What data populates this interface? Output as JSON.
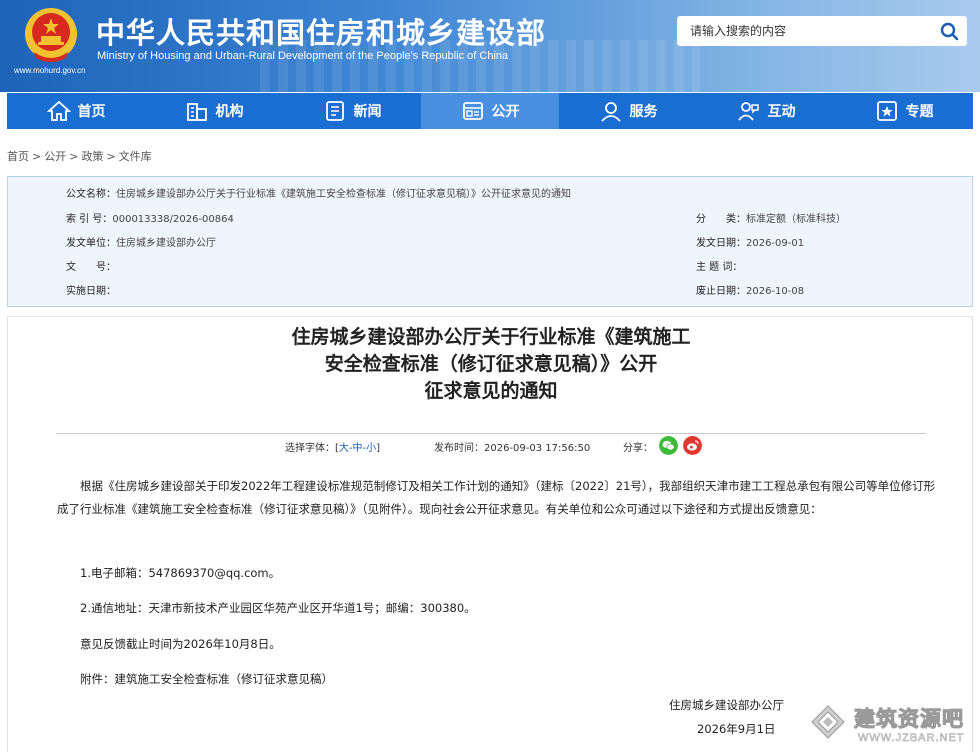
{
  "header": {
    "title": "中华人民共和国住房和城乡建设部",
    "subtitle": "Ministry of Housing and Urban-Rural Development of the People's Republic of China",
    "url": "www.mohurd.gov.cn",
    "search_placeholder": "请输入搜索的内容"
  },
  "nav": {
    "items": [
      {
        "label": "首页",
        "icon": "home-icon"
      },
      {
        "label": "机构",
        "icon": "building-icon"
      },
      {
        "label": "新闻",
        "icon": "news-icon"
      },
      {
        "label": "公开",
        "icon": "disclosure-icon"
      },
      {
        "label": "服务",
        "icon": "service-icon"
      },
      {
        "label": "互动",
        "icon": "interaction-icon"
      },
      {
        "label": "专题",
        "icon": "topic-icon"
      }
    ],
    "active_index": 3
  },
  "breadcrumb": [
    "首页",
    "公开",
    "政策",
    "文件库"
  ],
  "meta": {
    "doc_name_label": "公文名称：",
    "doc_name": "住房城乡建设部办公厅关于行业标准《建筑施工安全检查标准（修订征求意见稿）》公开征求意见的通知",
    "index_label": "索 引 号：",
    "index_value": "000013338/2026-00864",
    "category_label": "分　　类：",
    "category_value": "标准定额（标准科技）",
    "issuer_label": "发文单位：",
    "issuer_value": "住房城乡建设部办公厅",
    "issue_date_label": "发文日期：",
    "issue_date_value": "2026-09-01",
    "doc_no_label": "文　　号：",
    "doc_no_value": "",
    "subject_label": "主 题 词：",
    "subject_value": "",
    "effective_label": "实施日期：",
    "effective_value": "",
    "expiry_label": "废止日期：",
    "expiry_value": "2026-10-08"
  },
  "article": {
    "title_lines": [
      "住房城乡建设部办公厅关于行业标准《建筑施工",
      "安全检查标准（修订征求意见稿）》公开",
      "征求意见的通知"
    ],
    "font_label": "选择字体：[",
    "font_large": "大",
    "font_dash1": "-",
    "font_medium": "中",
    "font_dash2": "-",
    "font_small": "小",
    "font_end": "]",
    "publish_label": "发布时间：",
    "publish_time": "2026-09-03 17:56:50",
    "share_label": "分享：",
    "paragraphs": [
      "根据《住房城乡建设部关于印发2022年工程建设标准规范制修订及相关工作计划的通知》（建标〔2022〕21号），我部组织天津市建工工程总承包有限公司等单位修订形成了行业标准《建筑施工安全检查标准（修订征求意见稿）》（见附件）。现向社会公开征求意见。有关单位和公众可通过以下途径和方式提出反馈意见：",
      "1.电子邮箱：547869370@qq.com。",
      "2.通信地址：天津市新技术产业园区华苑产业区开华道1号；邮编：300380。",
      "意见反馈截止时间为2026年10月8日。",
      "附件：建筑施工安全检查标准（修订征求意见稿）"
    ],
    "signature": "住房城乡建设部办公厅",
    "date": "2026年9月1日"
  },
  "watermark": {
    "text": "建筑资源吧",
    "url": "WWW.JZBAR.NET"
  },
  "colors": {
    "nav_bg": "#1a6ed1",
    "nav_active": "#4a90e2",
    "meta_bg": "#eef5fc",
    "link": "#1a5fb4"
  }
}
